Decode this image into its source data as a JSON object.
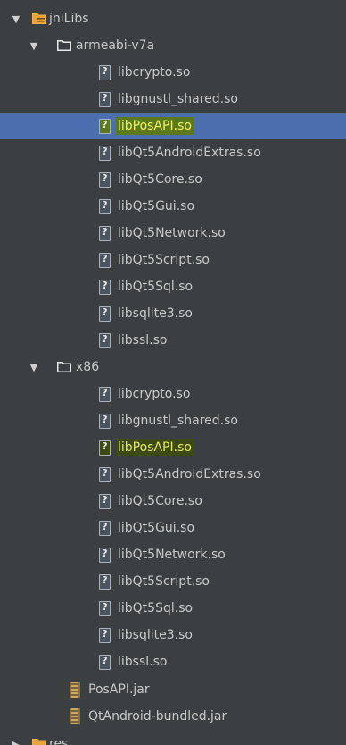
{
  "tree": {
    "jnilibs": {
      "label": "jniLibs",
      "expanded": true,
      "icon": "folder-icon"
    },
    "armeabi": {
      "label": "armeabi-v7a",
      "expanded": true,
      "files": [
        {
          "label": "libcrypto.so"
        },
        {
          "label": "libgnustl_shared.so"
        },
        {
          "label": "libPosAPI.so",
          "selected": true,
          "highlighted": true
        },
        {
          "label": "libQt5AndroidExtras.so"
        },
        {
          "label": "libQt5Core.so"
        },
        {
          "label": "libQt5Gui.so"
        },
        {
          "label": "libQt5Network.so"
        },
        {
          "label": "libQt5Script.so"
        },
        {
          "label": "libQt5Sql.so"
        },
        {
          "label": "libsqlite3.so"
        },
        {
          "label": "libssl.so"
        }
      ]
    },
    "x86": {
      "label": "x86",
      "expanded": true,
      "files": [
        {
          "label": "libcrypto.so"
        },
        {
          "label": "libgnustl_shared.so"
        },
        {
          "label": "libPosAPI.so",
          "highlighted": true
        },
        {
          "label": "libQt5AndroidExtras.so"
        },
        {
          "label": "libQt5Core.so"
        },
        {
          "label": "libQt5Gui.so"
        },
        {
          "label": "libQt5Network.so"
        },
        {
          "label": "libQt5Script.so"
        },
        {
          "label": "libQt5Sql.so"
        },
        {
          "label": "libsqlite3.so"
        },
        {
          "label": "libssl.so"
        }
      ]
    },
    "jars": [
      {
        "label": "PosAPI.jar"
      },
      {
        "label": "QtAndroid-bundled.jar"
      }
    ],
    "next_folder": {
      "label": "res"
    }
  },
  "colors": {
    "background": "#3c3f41",
    "selection": "#4b6eaf",
    "highlight_text": "#e4e86a",
    "folder": "#e8e8e8",
    "jnilibs_folder": "#e8a33c"
  }
}
